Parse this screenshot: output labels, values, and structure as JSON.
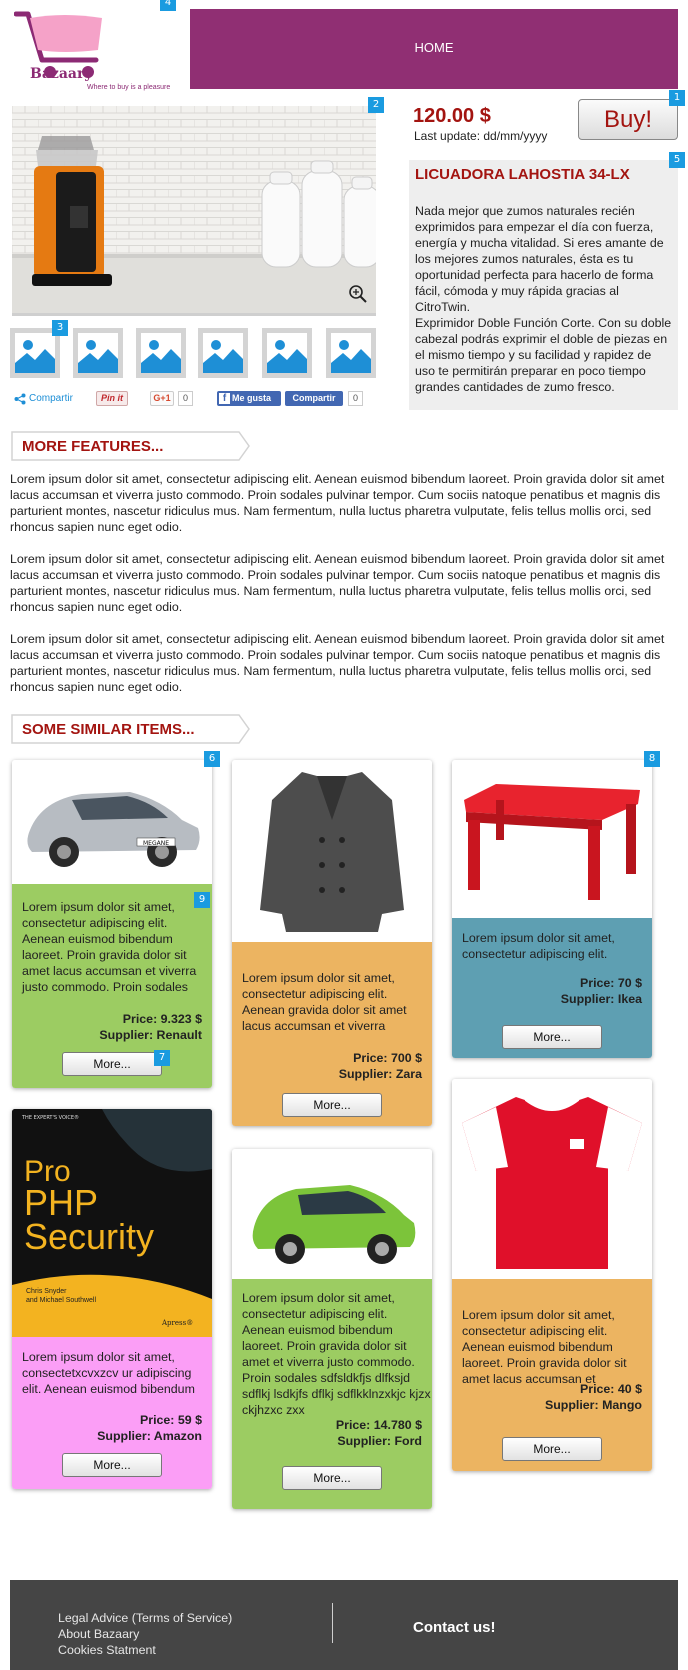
{
  "logo": {
    "name": "Bazaary",
    "tagline": "Where to buy is a pleasure"
  },
  "nav": {
    "home": "HOME"
  },
  "markers": [
    "1",
    "2",
    "3",
    "4",
    "5",
    "6",
    "7",
    "8",
    "9"
  ],
  "product": {
    "price": "120.00 $",
    "last_update": "Last update: dd/mm/yyyy",
    "buy_label": "Buy!",
    "title": "LICUADORA LAHOSTIA 34-LX",
    "description": "Nada mejor que zumos naturales recién exprimidos para empezar el día con fuerza, energía y mucha vitalidad. Si eres amante de los mejores zumos naturales, ésta es tu oportunidad perfecta para hacerlo de forma fácil, cómoda y muy rápida gracias al CitroTwin.\nExprimidor Doble Función Corte. Con su doble cabezal podrás exprimir el doble de piezas en el mismo tiempo y su facilidad y rapidez de uso te permitirán preparar en poco tiempo grandes cantidades de zumo fresco.",
    "image_icon": "zoom-icon"
  },
  "share": {
    "compartir": "Compartir",
    "pinit": "Pin it",
    "gplus": "G+1",
    "gplus_count": "0",
    "fb_like": "Me gusta",
    "fb_share": "Compartir",
    "fb_count": "0"
  },
  "sections": {
    "more_features": "MORE FEATURES...",
    "similar_items": "SOME SIMILAR ITEMS..."
  },
  "features": [
    "Lorem ipsum dolor sit amet, consectetur adipiscing elit. Aenean euismod bibendum laoreet. Proin gravida dolor sit amet lacus accumsan et viverra justo commodo. Proin sodales pulvinar tempor. Cum sociis natoque penatibus et magnis dis parturient montes, nascetur ridiculus mus. Nam fermentum, nulla luctus pharetra vulputate, felis tellus mollis orci, sed rhoncus sapien nunc eget odio.",
    "Lorem ipsum dolor sit amet, consectetur adipiscing elit. Aenean euismod bibendum laoreet. Proin gravida dolor sit amet lacus accumsan et viverra justo commodo. Proin sodales pulvinar tempor. Cum sociis natoque penatibus et magnis dis parturient montes, nascetur ridiculus mus. Nam fermentum, nulla luctus pharetra vulputate, felis tellus mollis orci, sed rhoncus sapien nunc eget odio.",
    "Lorem ipsum dolor sit amet, consectetur adipiscing elit. Aenean euismod bibendum laoreet. Proin gravida dolor sit amet lacus accumsan et viverra justo commodo. Proin sodales pulvinar tempor. Cum sociis natoque penatibus et magnis dis parturient montes, nascetur ridiculus mus. Nam fermentum, nulla luctus pharetra vulputate, felis tellus mollis orci, sed rhoncus sapien nunc eget odio."
  ],
  "items": [
    {
      "text": "Lorem ipsum dolor sit amet, consectetur adipiscing elit. Aenean euismod bibendum laoreet. Proin gravida dolor sit amet lacus accumsan et viverra justo commodo. Proin sodales",
      "price": "Price: 9.323 $",
      "supplier": "Supplier: Renault",
      "more": "More...",
      "color": "#9ccc62"
    },
    {
      "text": "Lorem ipsum dolor sit amet, consectetur adipiscing elit. Aenean gravida dolor sit amet lacus accumsan et viverra",
      "price": "Price: 700 $",
      "supplier": "Supplier: Zara",
      "more": "More...",
      "color": "#ecb461"
    },
    {
      "text": "Lorem ipsum dolor sit amet, consectetur adipiscing elit.",
      "price": "Price: 70 $",
      "supplier": "Supplier: Ikea",
      "more": "More...",
      "color": "#5e9fb2"
    },
    {
      "text": "Lorem ipsum dolor sit amet, consectetxcvxzcv ur adipiscing elit. Aenean euismod bibendum",
      "price": "Price: 59 $",
      "supplier": "Supplier: Amazon",
      "more": "More...",
      "color": "#fb9ef6"
    },
    {
      "text": "Lorem ipsum dolor sit amet, consectetur adipiscing elit. Aenean euismod bibendum laoreet. Proin gravida dolor sit amet et viverra justo commodo. Proin sodales sdfsldkfjs dlfksjd sdflkj lsdkjfs dflkj sdflkklnzxkjc kjzx ckjhzxc zxx",
      "price": "Price: 14.780 $",
      "supplier": "Supplier: Ford",
      "more": "More...",
      "color": "#9ccc62"
    },
    {
      "text": "Lorem ipsum dolor sit amet, consectetur adipiscing elit. Aenean euismod bibendum laoreet. Proin gravida dolor sit amet lacus accumsan et",
      "price": "Price: 40 $",
      "supplier": "Supplier: Mango",
      "more": "More...",
      "color": "#ecb461"
    }
  ],
  "book": {
    "series": "THE EXPERT'S VOICE®",
    "title_1": "Pro",
    "title_2": "PHP",
    "title_3": "Security",
    "authors_1": "Chris Snyder",
    "authors_2": "and Michael Southwell",
    "publisher": "Apress®"
  },
  "car_plate": "MEGANE",
  "footer": {
    "links": [
      "Legal Advice (Terms of Service)",
      "About Bazaary",
      "Cookies Statment"
    ],
    "contact": "Contact us!"
  }
}
